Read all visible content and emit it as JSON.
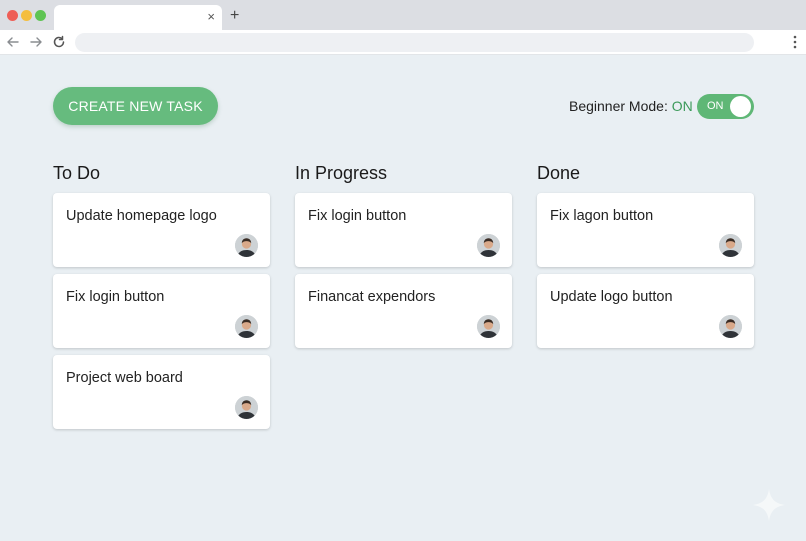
{
  "browser": {
    "tab_close": "×",
    "new_tab": "+"
  },
  "header": {
    "create_button": "CREATE NEW TASK",
    "mode_label": "Beginner Mode: ",
    "mode_value": "ON",
    "toggle_label": "ON",
    "toggle_state": true
  },
  "columns": [
    {
      "title": "To Do",
      "cards": [
        {
          "title": "Update homepage logo"
        },
        {
          "title": "Fix login button"
        },
        {
          "title": "Project web board"
        }
      ]
    },
    {
      "title": "In Progress",
      "cards": [
        {
          "title": "Fix login button"
        },
        {
          "title": "Financat expendors"
        }
      ]
    },
    {
      "title": "Done",
      "cards": [
        {
          "title": "Fix lagon button"
        },
        {
          "title": "Update logo button"
        }
      ]
    }
  ],
  "colors": {
    "accent": "#66bb7e",
    "toggle_on": "#5fb776",
    "mode_on_text": "#3c9a5a",
    "background": "#e9eff3"
  }
}
